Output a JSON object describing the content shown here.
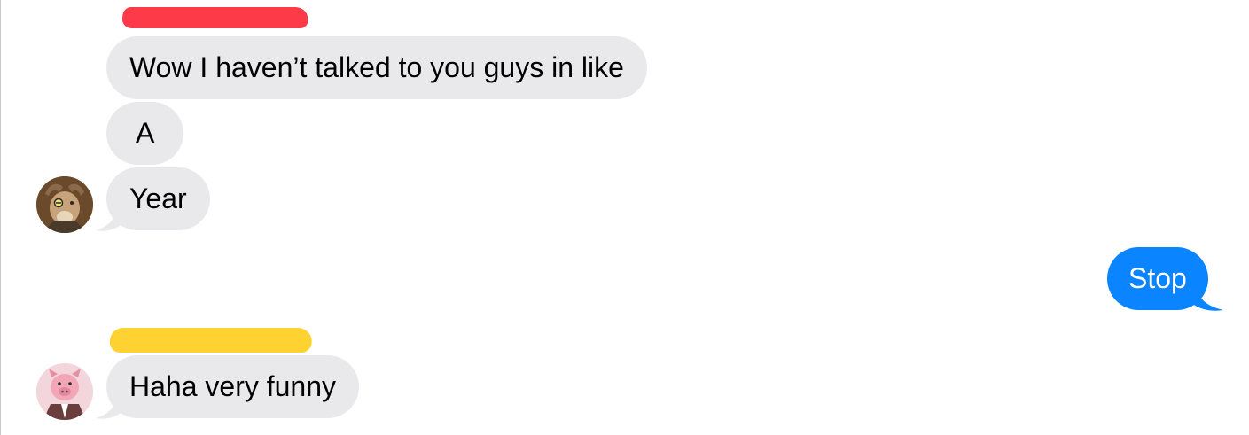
{
  "conversation": {
    "messages": [
      {
        "text": "Wow I haven’t talked to you guys in like"
      },
      {
        "text": "A"
      },
      {
        "text": "Year"
      },
      {
        "text": "Stop"
      },
      {
        "text": "Haha very funny"
      }
    ]
  },
  "colors": {
    "incoming_bubble": "#e9e9eb",
    "outgoing_bubble": "#0a84ff",
    "redaction_red": "#fc3a48",
    "redaction_yellow": "#fed331"
  },
  "icons": {
    "avatar_1": "goat-avatar-icon",
    "avatar_2": "pig-avatar-icon"
  }
}
